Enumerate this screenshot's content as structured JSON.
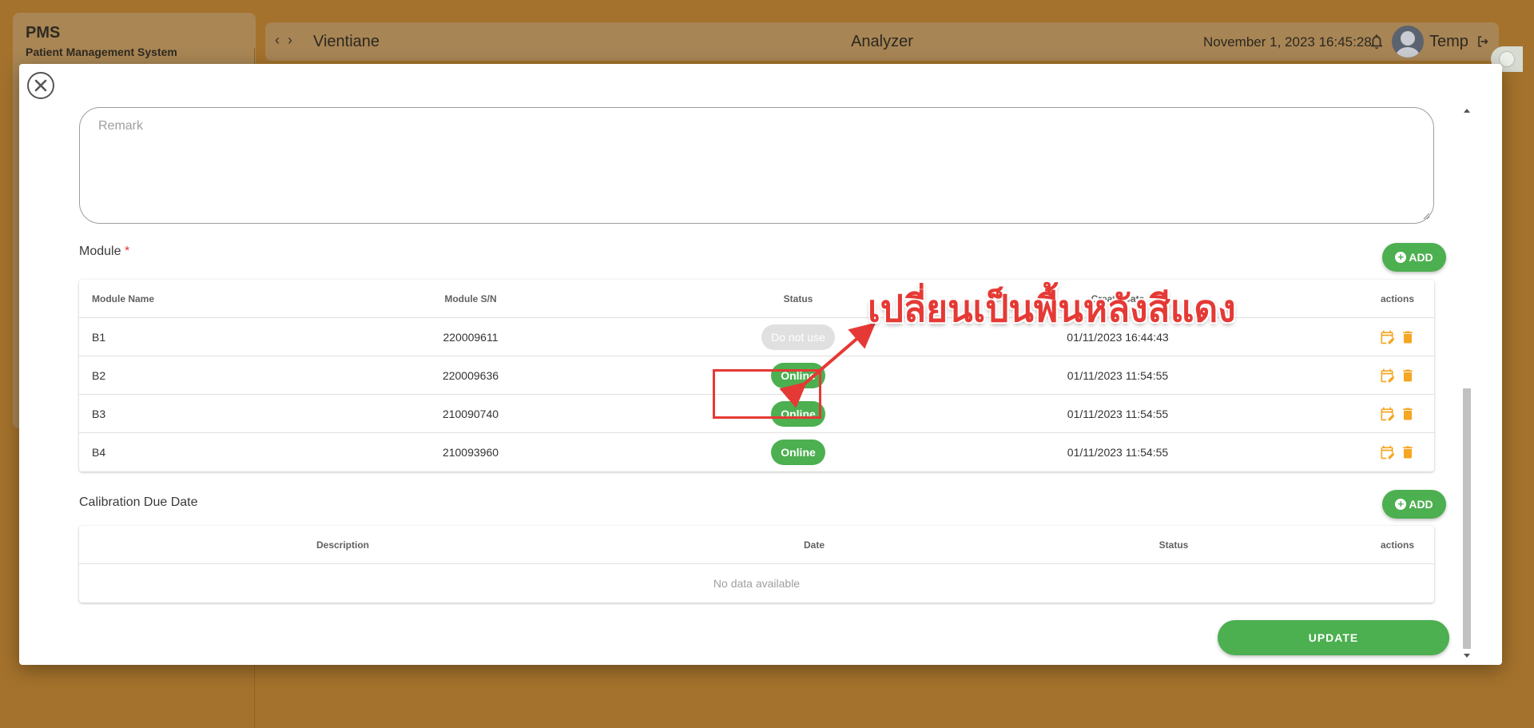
{
  "app": {
    "brand_title": "PMS",
    "brand_subtitle": "Patient Management System"
  },
  "topbar": {
    "location": "Vientiane",
    "page_title": "Analyzer",
    "datetime": "November 1, 2023 16:45:28",
    "user_name": "Temp"
  },
  "form": {
    "remark_placeholder": "Remark",
    "module_label": "Module",
    "required_mark": "*",
    "add_label": "ADD",
    "calibration_label": "Calibration Due Date",
    "update_label": "UPDATE"
  },
  "module_table": {
    "headers": [
      "Module Name",
      "Module S/N",
      "Status",
      "Create Date",
      "actions"
    ],
    "rows": [
      {
        "name": "B1",
        "sn": "220009611",
        "status": "Do not use",
        "status_type": "off",
        "created": "01/11/2023 16:44:43"
      },
      {
        "name": "B2",
        "sn": "220009636",
        "status": "Online",
        "status_type": "online",
        "created": "01/11/2023 11:54:55"
      },
      {
        "name": "B3",
        "sn": "210090740",
        "status": "Online",
        "status_type": "online",
        "created": "01/11/2023 11:54:55"
      },
      {
        "name": "B4",
        "sn": "210093960",
        "status": "Online",
        "status_type": "online",
        "created": "01/11/2023 11:54:55"
      }
    ]
  },
  "calibration_table": {
    "headers": [
      "Description",
      "Date",
      "Status",
      "actions"
    ],
    "empty_text": "No data available"
  },
  "annotation": {
    "text": "เปลี่ยนเป็นพื้นหลังสีแดง"
  },
  "colors": {
    "accent_green": "#4caf50",
    "action_orange": "#f5a623",
    "annotation_red": "#e53935",
    "backdrop": "#a4722c"
  }
}
